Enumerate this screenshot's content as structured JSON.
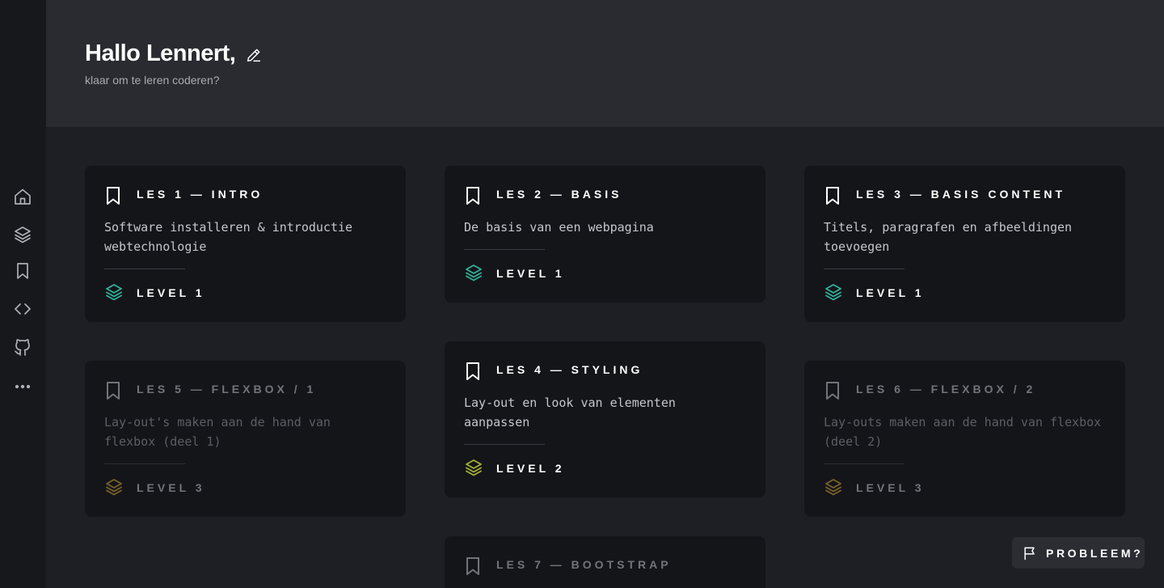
{
  "header": {
    "greeting": "Hallo Lennert,",
    "subtitle": "klaar om te leren coderen?"
  },
  "sidebar": {
    "items": [
      {
        "icon": "home-icon"
      },
      {
        "icon": "layers-icon"
      },
      {
        "icon": "bookmark-icon"
      },
      {
        "icon": "code-icon"
      },
      {
        "icon": "github-icon"
      },
      {
        "icon": "more-icon"
      }
    ]
  },
  "lessons": [
    {
      "title": "LES 1 — INTRO",
      "description": "Software installeren & introductie webtechnologie",
      "level": "LEVEL 1",
      "level_color": "#2bb59a",
      "locked": false
    },
    {
      "title": "LES 2 — BASIS",
      "description": "De basis van een webpagina",
      "level": "LEVEL 1",
      "level_color": "#2bb59a",
      "locked": false
    },
    {
      "title": "LES 3 — BASIS CONTENT",
      "description": "Titels, paragrafen en afbeeldingen toevoegen",
      "level": "LEVEL 1",
      "level_color": "#2bb59a",
      "locked": false
    },
    {
      "title": "LES 4 — STYLING",
      "description": "Lay-out en look van elementen aanpassen",
      "level": "LEVEL 2",
      "level_color": "#a8b32c",
      "locked": false
    },
    {
      "title": "LES 5 — FLEXBOX / 1",
      "description": "Lay-out's maken aan de hand van flexbox (deel 1)",
      "level": "LEVEL 3",
      "level_color": "#7a6428",
      "locked": true
    },
    {
      "title": "LES 6 — FLEXBOX / 2",
      "description": "Lay-outs maken aan de hand van flexbox (deel 2)",
      "level": "LEVEL 3",
      "level_color": "#7a6428",
      "locked": true
    },
    {
      "title": "LES 7 — BOOTSTRAP",
      "description": "",
      "level": "",
      "level_color": "",
      "locked": true
    }
  ],
  "problem_button": {
    "label": "PROBLEEM?"
  }
}
